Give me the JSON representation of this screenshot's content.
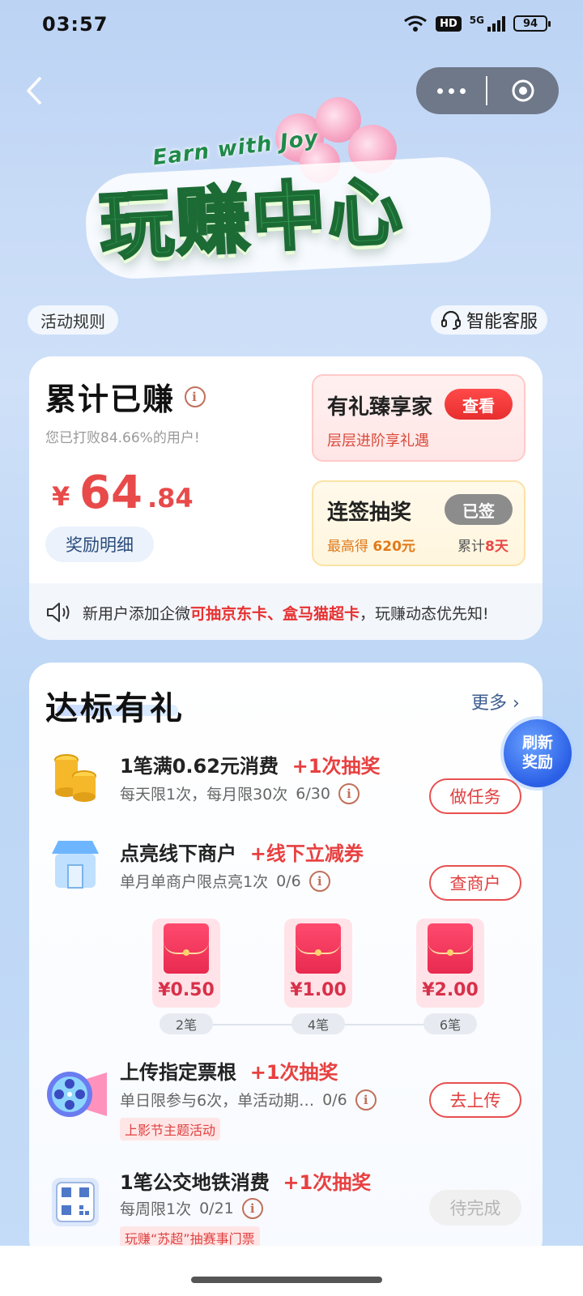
{
  "status_bar": {
    "time": "03:57",
    "hd": "HD",
    "network": "5G",
    "battery": "94"
  },
  "nav": {
    "back_icon": "chevron-left-icon",
    "more_icon": "more-dots-icon",
    "close_icon": "close-circle-icon"
  },
  "hero": {
    "subtitle": "Earn with Joy",
    "title": "玩赚中心"
  },
  "header_links": {
    "rules": "活动规则",
    "service": "智能客服",
    "service_icon": "headset-icon"
  },
  "earnings": {
    "title": "累计已赚",
    "subtitle": "您已打败84.66%的用户!",
    "currency": "¥",
    "amount_int": "64",
    "amount_dec": ".84",
    "detail_button": "奖励明细",
    "vip": {
      "title": "有礼臻享家",
      "button": "查看",
      "subtitle": "层层进阶享礼遇"
    },
    "signin": {
      "title": "连签抽奖",
      "button": "已签",
      "max_prefix": "最高得 ",
      "max_value": "620元",
      "total_prefix": "累计",
      "total_value": "8天"
    },
    "notice": {
      "icon": "speaker-icon",
      "before": "新用户添加企微",
      "highlight": "可抽京东卡、盒马猫超卡",
      "after": "，玩赚动态优先知!"
    }
  },
  "tasks": {
    "title": "达标有礼",
    "more": "更多 ›",
    "refresh_line1": "刷新",
    "refresh_line2": "奖励",
    "items": [
      {
        "icon": "gold-coins-icon",
        "title": "1笔满0.62元消费",
        "reward": "+1次抽奖",
        "desc": "每天限1次，每月限30次",
        "progress": "6/30",
        "button": "做任务"
      },
      {
        "icon": "storefront-icon",
        "title": "点亮线下商户",
        "reward": "+线下立减券",
        "desc": "单月单商户限点亮1次",
        "progress": "0/6",
        "button": "查商户"
      },
      {
        "icon": "film-reel-icon",
        "title": "上传指定票根",
        "reward": "+1次抽奖",
        "desc": "单日限参与6次，单活动期…",
        "progress": "0/6",
        "button": "去上传",
        "tag": "上影节主题活动"
      },
      {
        "icon": "qr-code-icon",
        "title": "1笔公交地铁消费",
        "reward": "+1次抽奖",
        "desc": "每周限1次",
        "progress": "0/21",
        "button": "待完成",
        "tag": "玩赚“苏超”抽赛事门票"
      }
    ],
    "packets": [
      {
        "amount": "¥0.50",
        "step": "2笔"
      },
      {
        "amount": "¥1.00",
        "step": "4笔"
      },
      {
        "amount": "¥2.00",
        "step": "6笔"
      }
    ]
  },
  "colors": {
    "accent_red": "#e84040",
    "price_red": "#e84a4a",
    "title_green": "#2f9a4c",
    "link_blue": "#3e5f8f"
  }
}
